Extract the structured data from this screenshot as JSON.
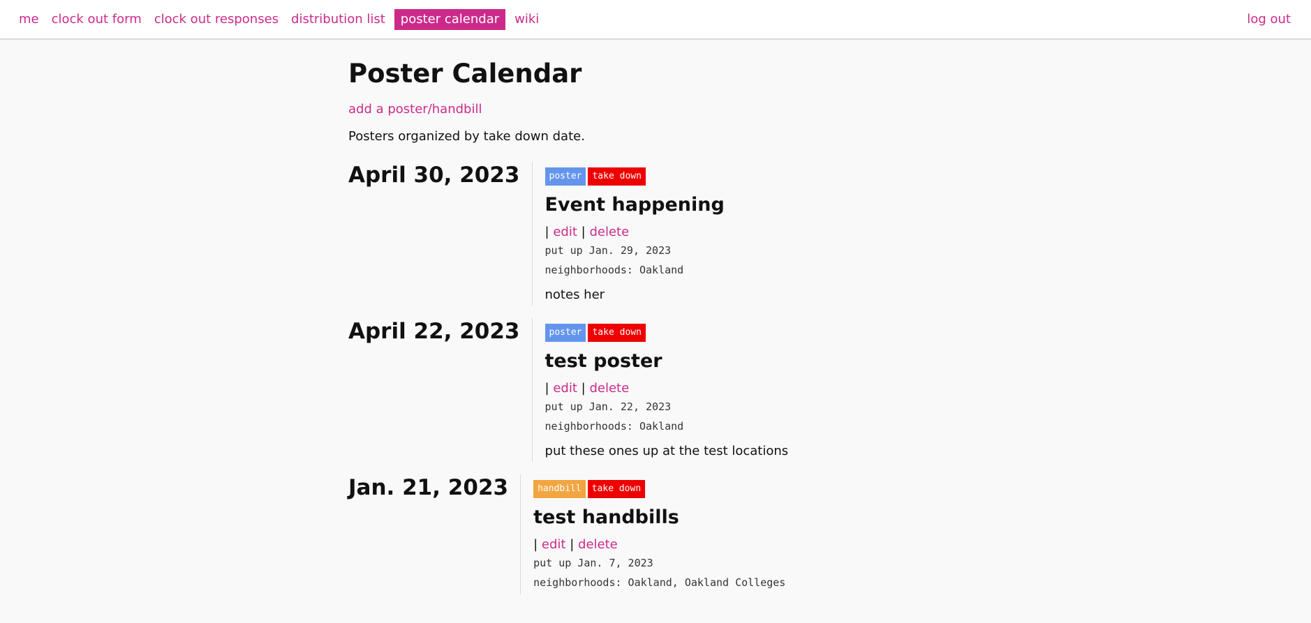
{
  "nav": {
    "items": [
      {
        "label": "me",
        "active": false
      },
      {
        "label": "clock out form",
        "active": false
      },
      {
        "label": "clock out responses",
        "active": false
      },
      {
        "label": "distribution list",
        "active": false
      },
      {
        "label": "poster calendar",
        "active": true
      },
      {
        "label": "wiki",
        "active": false
      }
    ],
    "logout_label": "log out"
  },
  "page": {
    "title": "Poster Calendar",
    "add_link": "add a poster/handbill",
    "intro": "Posters organized by take down date."
  },
  "entries": [
    {
      "date": "April 30, 2023",
      "type": "poster",
      "status": "take down",
      "title": "Event happening",
      "sep1": "|",
      "edit": "edit",
      "sep2": "|",
      "delete": "delete",
      "put_up": "put up Jan. 29, 2023",
      "neighborhoods": "neighborhoods: Oakland",
      "notes": "notes her"
    },
    {
      "date": "April 22, 2023",
      "type": "poster",
      "status": "take down",
      "title": "test poster",
      "sep1": "|",
      "edit": "edit",
      "sep2": "|",
      "delete": "delete",
      "put_up": "put up Jan. 22, 2023",
      "neighborhoods": "neighborhoods: Oakland",
      "notes": "put these ones up at the test locations"
    },
    {
      "date": "Jan. 21, 2023",
      "type": "handbill",
      "status": "take down",
      "title": "test handbills",
      "sep1": "|",
      "edit": "edit",
      "sep2": "|",
      "delete": "delete",
      "put_up": "put up Jan. 7, 2023",
      "neighborhoods": "neighborhoods: Oakland, Oakland Colleges",
      "notes": ""
    }
  ],
  "colors": {
    "accent": "#cc2a8a",
    "poster_tag": "#6495ed",
    "handbill_tag": "#f2a541",
    "takedown_tag": "#ee0000"
  }
}
